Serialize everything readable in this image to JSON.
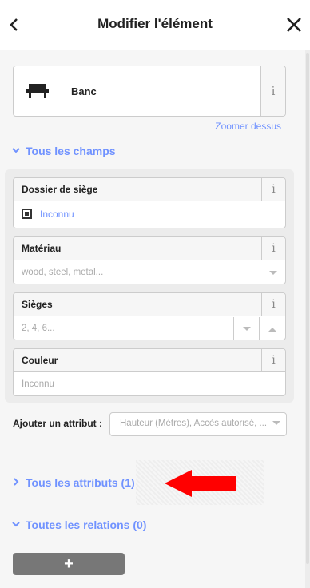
{
  "header": {
    "title": "Modifier l'élément",
    "back_icon": "chevron-left-icon",
    "close_icon": "close-icon"
  },
  "preset": {
    "name": "Banc",
    "icon": "bench-icon",
    "info_label": "i"
  },
  "zoom_link": "Zoomer dessus",
  "fields_section": {
    "label": "Tous les champs",
    "expanded": true,
    "fields": [
      {
        "label": "Dossier de siège",
        "type": "check",
        "value": "Inconnu"
      },
      {
        "label": "Matériau",
        "type": "combo",
        "placeholder": "wood, steel, metal..."
      },
      {
        "label": "Sièges",
        "type": "number",
        "placeholder": "2, 4, 6..."
      },
      {
        "label": "Couleur",
        "type": "text",
        "placeholder": "Inconnu"
      }
    ]
  },
  "add_attribute": {
    "label": "Ajouter un attribut :",
    "placeholder": "Hauteur (Mètres), Accès autorisé, ..."
  },
  "attributes_section": {
    "label": "Tous les attributs (1)",
    "expanded": false
  },
  "relations_section": {
    "label": "Toutes les relations (0)",
    "expanded": true
  },
  "add_button": {
    "label": "+"
  },
  "colors": {
    "accent": "#7092ff",
    "annotation_arrow": "#ff0000"
  }
}
